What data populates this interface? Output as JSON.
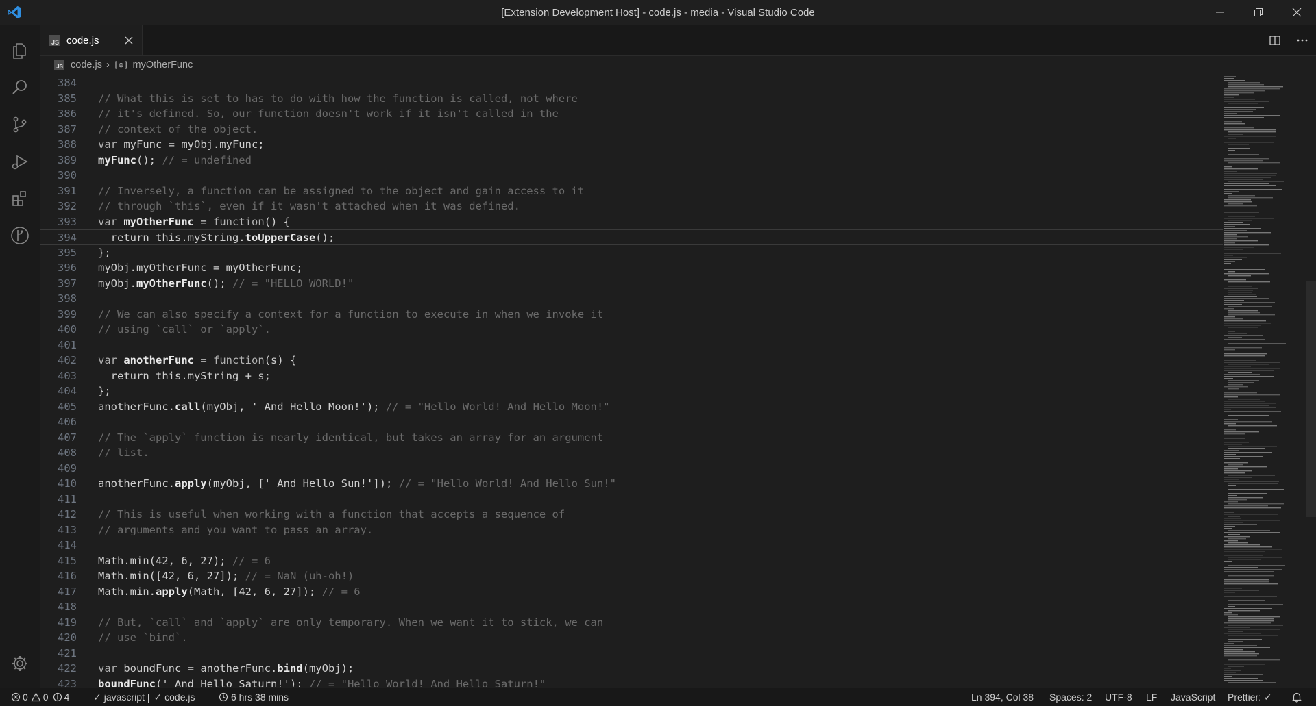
{
  "window": {
    "title": "[Extension Development Host] - code.js - media - Visual Studio Code"
  },
  "tab": {
    "label": "code.js",
    "icon_text": "JS"
  },
  "breadcrumb": {
    "file": "code.js",
    "symbol": "myOtherFunc"
  },
  "editor": {
    "current_line": 394,
    "lines": [
      {
        "n": "384",
        "code": ""
      },
      {
        "n": "385",
        "code": "// What this is set to has to do with how the function is called, not where"
      },
      {
        "n": "386",
        "code": "// it's defined. So, our function doesn't work if it isn't called in the"
      },
      {
        "n": "387",
        "code": "// context of the object."
      },
      {
        "n": "388",
        "code": "var myFunc = myObj.myFunc;"
      },
      {
        "n": "389",
        "code": "myFunc(); // = undefined"
      },
      {
        "n": "390",
        "code": ""
      },
      {
        "n": "391",
        "code": "// Inversely, a function can be assigned to the object and gain access to it"
      },
      {
        "n": "392",
        "code": "// through `this`, even if it wasn't attached when it was defined."
      },
      {
        "n": "393",
        "code": "var myOtherFunc = function() {"
      },
      {
        "n": "394",
        "code": "  return this.myString.toUpperCase();"
      },
      {
        "n": "395",
        "code": "};"
      },
      {
        "n": "396",
        "code": "myObj.myOtherFunc = myOtherFunc;"
      },
      {
        "n": "397",
        "code": "myObj.myOtherFunc(); // = \"HELLO WORLD!\""
      },
      {
        "n": "398",
        "code": ""
      },
      {
        "n": "399",
        "code": "// We can also specify a context for a function to execute in when we invoke it"
      },
      {
        "n": "400",
        "code": "// using `call` or `apply`."
      },
      {
        "n": "401",
        "code": ""
      },
      {
        "n": "402",
        "code": "var anotherFunc = function(s) {"
      },
      {
        "n": "403",
        "code": "  return this.myString + s;"
      },
      {
        "n": "404",
        "code": "};"
      },
      {
        "n": "405",
        "code": "anotherFunc.call(myObj, ' And Hello Moon!'); // = \"Hello World! And Hello Moon!\""
      },
      {
        "n": "406",
        "code": ""
      },
      {
        "n": "407",
        "code": "// The `apply` function is nearly identical, but takes an array for an argument"
      },
      {
        "n": "408",
        "code": "// list."
      },
      {
        "n": "409",
        "code": ""
      },
      {
        "n": "410",
        "code": "anotherFunc.apply(myObj, [' And Hello Sun!']); // = \"Hello World! And Hello Sun!\""
      },
      {
        "n": "411",
        "code": ""
      },
      {
        "n": "412",
        "code": "// This is useful when working with a function that accepts a sequence of"
      },
      {
        "n": "413",
        "code": "// arguments and you want to pass an array."
      },
      {
        "n": "414",
        "code": ""
      },
      {
        "n": "415",
        "code": "Math.min(42, 6, 27); // = 6"
      },
      {
        "n": "416",
        "code": "Math.min([42, 6, 27]); // = NaN (uh-oh!)"
      },
      {
        "n": "417",
        "code": "Math.min.apply(Math, [42, 6, 27]); // = 6"
      },
      {
        "n": "418",
        "code": ""
      },
      {
        "n": "419",
        "code": "// But, `call` and `apply` are only temporary. When we want it to stick, we can"
      },
      {
        "n": "420",
        "code": "// use `bind`."
      },
      {
        "n": "421",
        "code": ""
      },
      {
        "n": "422",
        "code": "var boundFunc = anotherFunc.bind(myObj);"
      },
      {
        "n": "423",
        "code": "boundFunc(' And Hello Saturn!'); // = \"Hello World! And Hello Saturn!\""
      }
    ]
  },
  "statusbar": {
    "errors": "0",
    "warnings": "0",
    "infos": "4",
    "lang_check": "javascript |",
    "file_check": "code.js",
    "time_tracked": "6 hrs 38 mins",
    "position": "Ln 394, Col 38",
    "spaces": "Spaces: 2",
    "encoding": "UTF-8",
    "eol": "LF",
    "language": "JavaScript",
    "prettier": "Prettier: ✓"
  },
  "colors": {
    "background": "#1e1e1e",
    "comment": "#6a6a6a",
    "accent": "#007acc"
  }
}
